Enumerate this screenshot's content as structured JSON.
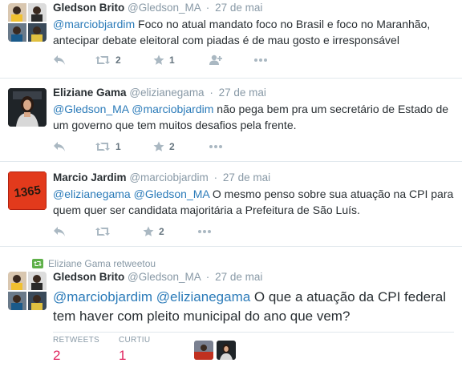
{
  "tweets": [
    {
      "name": "Gledson Brito",
      "handle": "@Gledson_MA",
      "time": "27 de mai",
      "text_prefix": "@marciobjardim",
      "text_rest": " Foco no atual mandato foco no Brasil e foco no Maranhão, antecipar debate eleitoral com piadas é de mau gosto e irresponsável",
      "retweets": "2",
      "likes": "1"
    },
    {
      "name": "Eliziane Gama",
      "handle": "@elizianegama",
      "time": "27 de mai",
      "mention1": "@Gledson_MA",
      "mention2": "@marciobjardim",
      "text_rest": " não pega bem pra um secretário de Estado de um governo que tem muitos desafios pela frente.",
      "retweets": "1",
      "likes": "2"
    },
    {
      "name": "Marcio Jardim",
      "handle": "@marciobjardim",
      "time": "27 de mai",
      "avatar_text": "1365",
      "mention1": "@elizianegama",
      "mention2": "@Gledson_MA",
      "text_rest": " O mesmo penso sobre sua atuação na CPI para quem quer ser candidata majoritária a Prefeitura de São Luís.",
      "likes": "2"
    },
    {
      "retweet_context": "Eliziane Gama retweetou",
      "name": "Gledson Brito",
      "handle": "@Gledson_MA",
      "time": "27 de mai",
      "mention1": "@marciobjardim",
      "mention2": "@elizianegama",
      "text_rest": " O que a atuação da CPI federal tem haver com pleito municipal do ano que vem?",
      "stats": {
        "retweets_label": "RETWEETS",
        "retweets_value": "2",
        "likes_label": "CURTIU",
        "likes_value": "1"
      }
    }
  ],
  "colors": {
    "link": "#2b7bb9",
    "muted": "#8899a6",
    "action": "#aab8c2",
    "stat_value": "#e0245e",
    "retweet_badge": "#5fb04a"
  },
  "icons": [
    "reply-icon",
    "retweet-icon",
    "star-icon",
    "follow-icon",
    "more-icon"
  ]
}
